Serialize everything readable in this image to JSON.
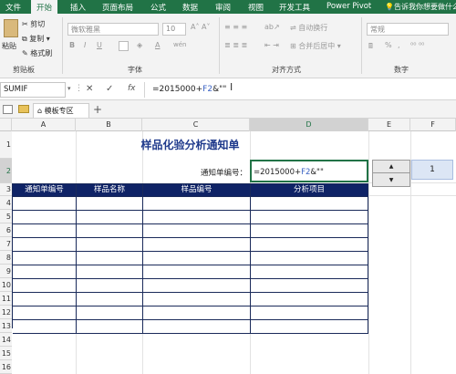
{
  "ribbon_tabs": [
    "文件",
    "开始",
    "插入",
    "页面布局",
    "公式",
    "数据",
    "审阅",
    "视图",
    "开发工具",
    "Power Pivot"
  ],
  "tell_me": "告诉我你想要做什么",
  "clipboard": {
    "paste": "粘贴",
    "cut": "剪切",
    "copy": "复制",
    "format_painter": "格式刷",
    "group": "剪贴板"
  },
  "font": {
    "name": "微软雅黑",
    "size": "10",
    "bold": "B",
    "italic": "I",
    "underline": "U",
    "font_color": "A",
    "wen": "wén",
    "group": "字体"
  },
  "alignment": {
    "wrap": "自动换行",
    "merge": "合并后居中",
    "group": "对齐方式"
  },
  "number": {
    "format": "常规",
    "percent": "%",
    "comma": ",",
    "group": "数字"
  },
  "formula_bar": {
    "name_box": "SUMIF",
    "formula_prefix": "=2015000+",
    "formula_ref": "F2",
    "formula_suffix": "&\"\"",
    "cancel": "✕",
    "enter": "✓",
    "fx": "fx"
  },
  "sheet_tabs": {
    "template_zone": "模板专区",
    "add": "+"
  },
  "columns": [
    "A",
    "B",
    "C",
    "D",
    "E",
    "F"
  ],
  "rows": [
    "1",
    "2",
    "3",
    "4",
    "5",
    "6",
    "7",
    "8",
    "9",
    "10",
    "11",
    "12",
    "13",
    "14",
    "15",
    "16"
  ],
  "sheet": {
    "title": "样品化验分析通知单",
    "notice_label": "通知单编号：",
    "edit_prefix": "=2015000+",
    "edit_ref": "F2",
    "edit_suffix": "&\"\"",
    "spin_up": "▲",
    "spin_down": "▼",
    "f2_value": "1",
    "headers": [
      "通知单编号",
      "样品名称",
      "样品编号",
      "分析项目"
    ]
  },
  "colors": {
    "excel_green": "#217346",
    "table_header": "#0f2366",
    "title_blue": "#1f3a8c",
    "ref_blue": "#3b63c4"
  }
}
